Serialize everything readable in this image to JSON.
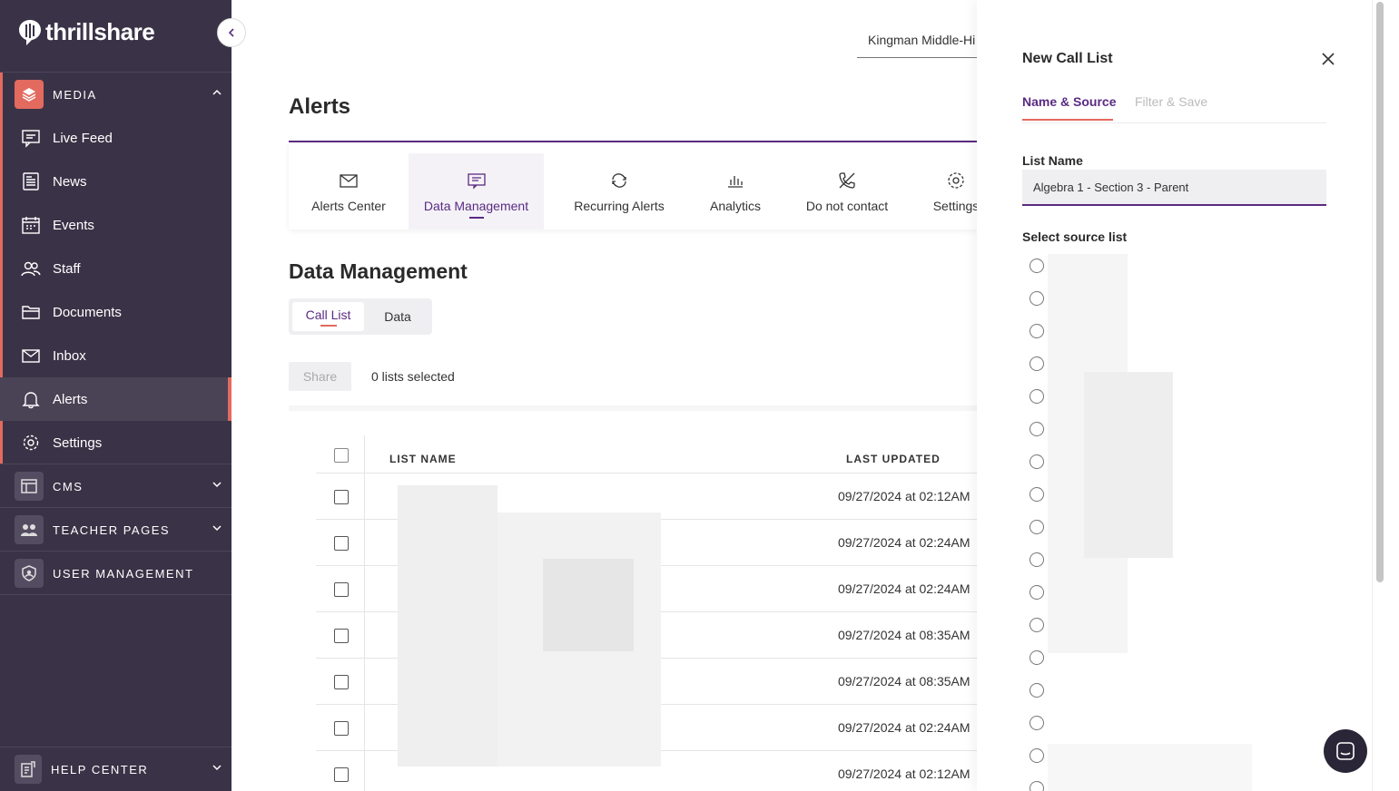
{
  "brand": {
    "name": "thrillshare"
  },
  "sidebar": {
    "sections": [
      {
        "label": "MEDIA",
        "icon": "layers-icon",
        "expanded": true
      },
      {
        "label": "CMS",
        "icon": "layout-icon"
      },
      {
        "label": "TEACHER PAGES",
        "icon": "people-icon"
      },
      {
        "label": "USER MANAGEMENT",
        "icon": "shield-user-icon"
      },
      {
        "label": "HELP CENTER",
        "icon": "help-doc-icon"
      }
    ],
    "items": [
      {
        "label": "Live Feed",
        "icon": "feed-icon"
      },
      {
        "label": "News",
        "icon": "news-icon"
      },
      {
        "label": "Events",
        "icon": "calendar-icon"
      },
      {
        "label": "Staff",
        "icon": "staff-icon"
      },
      {
        "label": "Documents",
        "icon": "folder-icon"
      },
      {
        "label": "Inbox",
        "icon": "mail-icon"
      },
      {
        "label": "Alerts",
        "icon": "bell-icon",
        "active": true
      },
      {
        "label": "Settings",
        "icon": "gear-icon"
      }
    ]
  },
  "header": {
    "school": "Kingman Middle-Hi"
  },
  "page": {
    "title": "Alerts",
    "tabs": [
      {
        "label": "Alerts Center",
        "icon": "envelope-icon"
      },
      {
        "label": "Data Management",
        "icon": "message-icon",
        "active": true
      },
      {
        "label": "Recurring Alerts",
        "icon": "refresh-icon"
      },
      {
        "label": "Analytics",
        "icon": "bar-chart-icon"
      },
      {
        "label": "Do not contact",
        "icon": "phone-off-icon"
      },
      {
        "label": "Settings",
        "icon": "gear-icon"
      }
    ],
    "section_title": "Data Management",
    "segments": [
      {
        "label": "Call List",
        "active": true
      },
      {
        "label": "Data"
      }
    ],
    "share_label": "Share",
    "selected_text": "0 lists selected",
    "table": {
      "columns": [
        "LIST NAME",
        "LAST UPDATED"
      ],
      "rows": [
        {
          "updated": "09/27/2024 at 02:12AM"
        },
        {
          "updated": "09/27/2024 at 02:24AM"
        },
        {
          "updated": "09/27/2024 at 02:24AM"
        },
        {
          "updated": "09/27/2024 at 08:35AM"
        },
        {
          "updated": "09/27/2024 at 08:35AM"
        },
        {
          "updated": "09/27/2024 at 02:24AM"
        },
        {
          "updated": "09/27/2024 at 02:12AM"
        }
      ]
    }
  },
  "panel": {
    "title": "New Call List",
    "tabs": [
      {
        "label": "Name & Source",
        "active": true
      },
      {
        "label": "Filter & Save"
      }
    ],
    "list_name_label": "List Name",
    "list_name_value": "Algebra 1 - Section 3 - Parent",
    "source_label": "Select source list",
    "source_options_count": 17
  },
  "colors": {
    "sidebar": "#3a3347",
    "accent": "#5a2a82",
    "highlight": "#e36a5e"
  }
}
